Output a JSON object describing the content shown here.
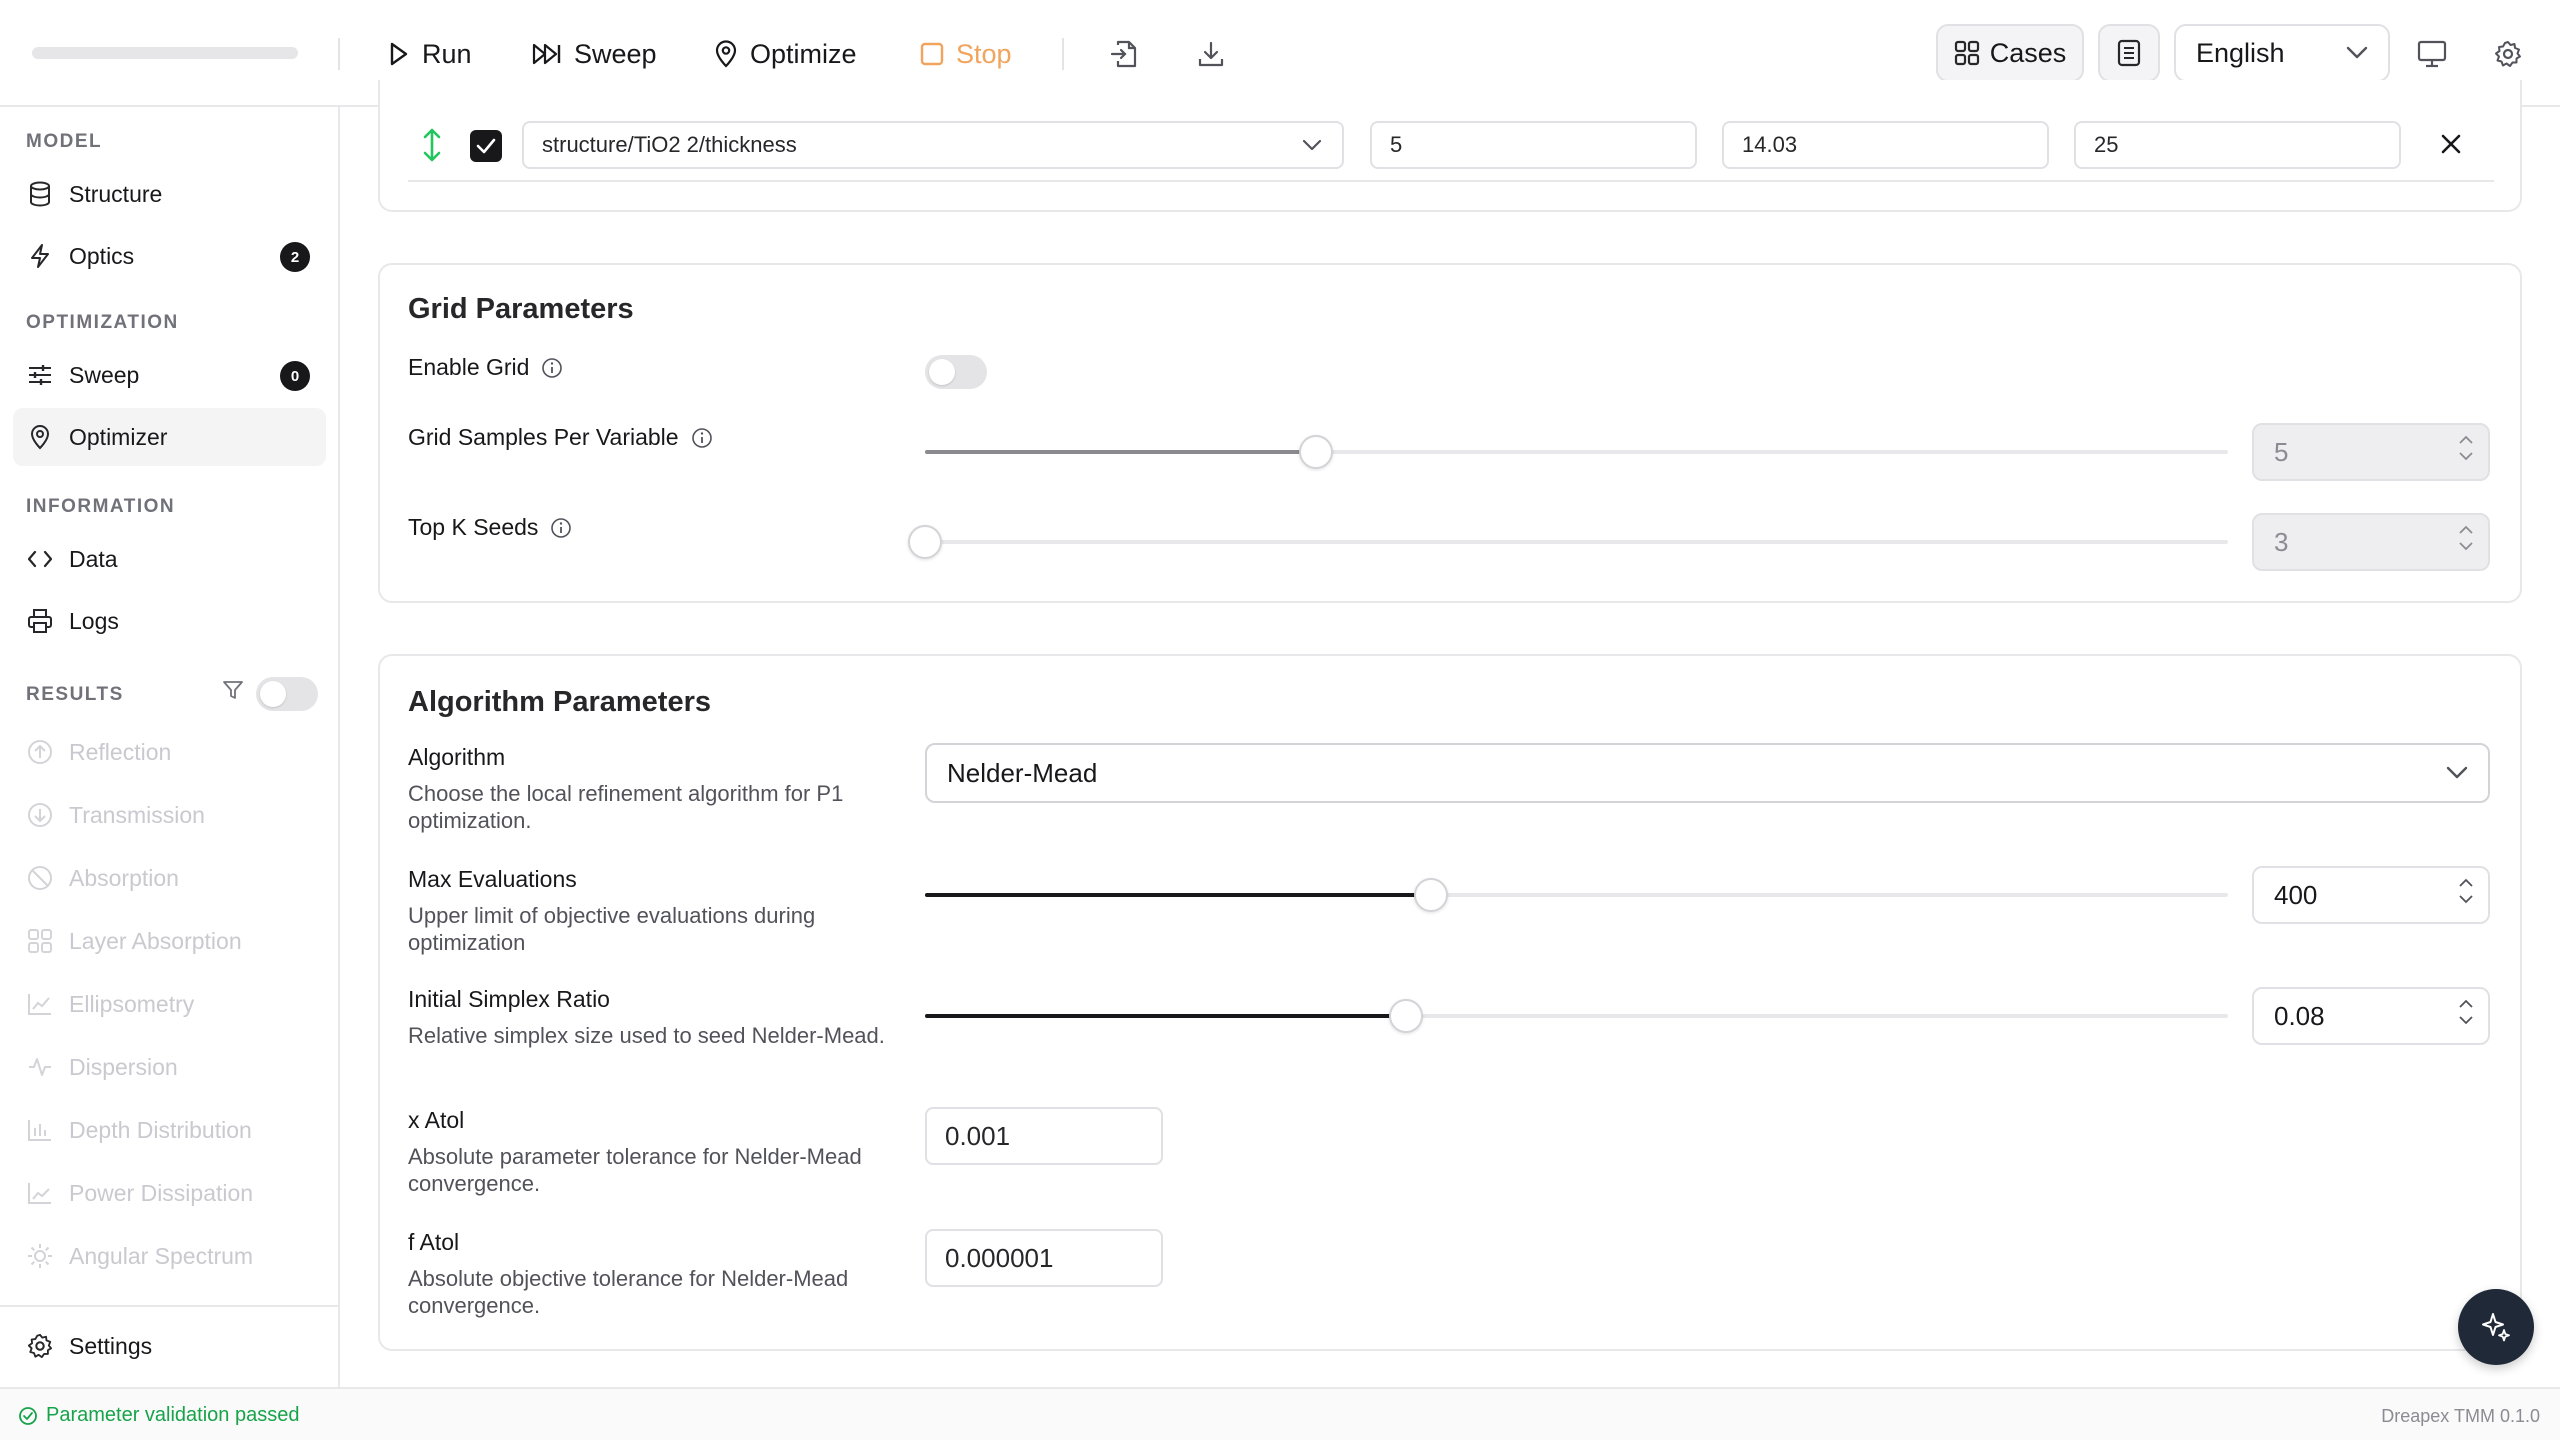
{
  "toolbar": {
    "run_label": "Run",
    "sweep_label": "Sweep",
    "optimize_label": "Optimize",
    "stop_label": "Stop",
    "cases_label": "Cases",
    "language": "English",
    "stop_color": "#f0a45d"
  },
  "sidebar": {
    "model_label": "MODEL",
    "structure_label": "Structure",
    "optics_label": "Optics",
    "optics_badge": "2",
    "optimization_label": "OPTIMIZATION",
    "sweep_label": "Sweep",
    "sweep_badge": "0",
    "optimizer_label": "Optimizer",
    "information_label": "INFORMATION",
    "data_label": "Data",
    "logs_label": "Logs",
    "results_label": "RESULTS",
    "results": {
      "reflection": "Reflection",
      "transmission": "Transmission",
      "absorption": "Absorption",
      "layer_absorption": "Layer Absorption",
      "ellipsometry": "Ellipsometry",
      "dispersion": "Dispersion",
      "depth_distribution": "Depth Distribution",
      "power_dissipation": "Power Dissipation",
      "angular_spectrum": "Angular Spectrum"
    },
    "settings_label": "Settings"
  },
  "variable_row": {
    "path": "structure/TiO2 2/thickness",
    "min": "5",
    "initial": "14.03",
    "max": "25",
    "checked": true
  },
  "grid": {
    "title": "Grid Parameters",
    "enable_label": "Enable Grid",
    "enabled": false,
    "samples_label": "Grid Samples Per Variable",
    "samples_value": "5",
    "samples_fraction": 0.3,
    "topk_label": "Top K Seeds",
    "topk_value": "3",
    "topk_fraction": 0.0
  },
  "algorithm": {
    "title": "Algorithm Parameters",
    "algorithm_label": "Algorithm",
    "algorithm_desc": "Choose the local refinement algorithm for P1 optimization.",
    "algorithm_value": "Nelder-Mead",
    "max_eval_label": "Max Evaluations",
    "max_eval_desc": "Upper limit of objective evaluations during optimization",
    "max_eval_value": "400",
    "max_eval_fraction": 0.388,
    "simplex_label": "Initial Simplex Ratio",
    "simplex_desc": "Relative simplex size used to seed Nelder-Mead.",
    "simplex_value": "0.08",
    "simplex_fraction": 0.369,
    "xatol_label": "x Atol",
    "xatol_desc": "Absolute parameter tolerance for Nelder-Mead convergence.",
    "xatol_value": "0.001",
    "fatol_label": "f Atol",
    "fatol_desc": "Absolute objective tolerance for Nelder-Mead convergence.",
    "fatol_value": "0.000001"
  },
  "status": {
    "message": "Parameter validation passed",
    "version": "Dreapex TMM 0.1.0"
  }
}
